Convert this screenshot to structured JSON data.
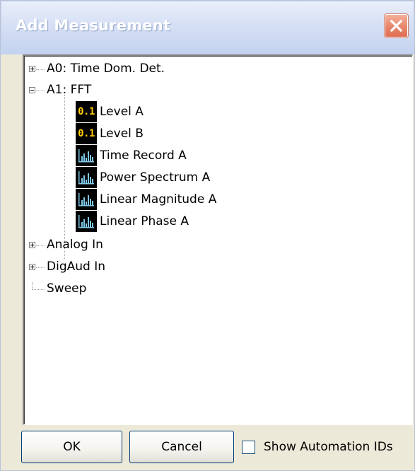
{
  "window": {
    "title": "Add Measurement"
  },
  "tree": {
    "nodes": [
      {
        "label": "A0: Time Dom. Det.",
        "expander": "plus"
      },
      {
        "label": "A1: FFT",
        "expander": "minus"
      },
      {
        "label": "Level A",
        "icon": "level-readout-icon",
        "icon_text": "0.1"
      },
      {
        "label": "Level B",
        "icon": "level-readout-icon",
        "icon_text": "0.1"
      },
      {
        "label": "Time Record A",
        "icon": "graph-icon"
      },
      {
        "label": "Power Spectrum A",
        "icon": "graph-icon"
      },
      {
        "label": "Linear Magnitude A",
        "icon": "graph-icon"
      },
      {
        "label": "Linear Phase A",
        "icon": "graph-icon"
      },
      {
        "label": "Analog In",
        "expander": "plus"
      },
      {
        "label": "DigAud In",
        "expander": "plus"
      },
      {
        "label": "Sweep"
      }
    ]
  },
  "buttons": {
    "ok": "OK",
    "cancel": "Cancel"
  },
  "checkbox": {
    "label": "Show Automation IDs",
    "checked": false
  },
  "colors": {
    "level_icon_text": "#ffcc00",
    "graph_icon_bars": "#7ec8e8",
    "close_button": "#e07a5f"
  }
}
